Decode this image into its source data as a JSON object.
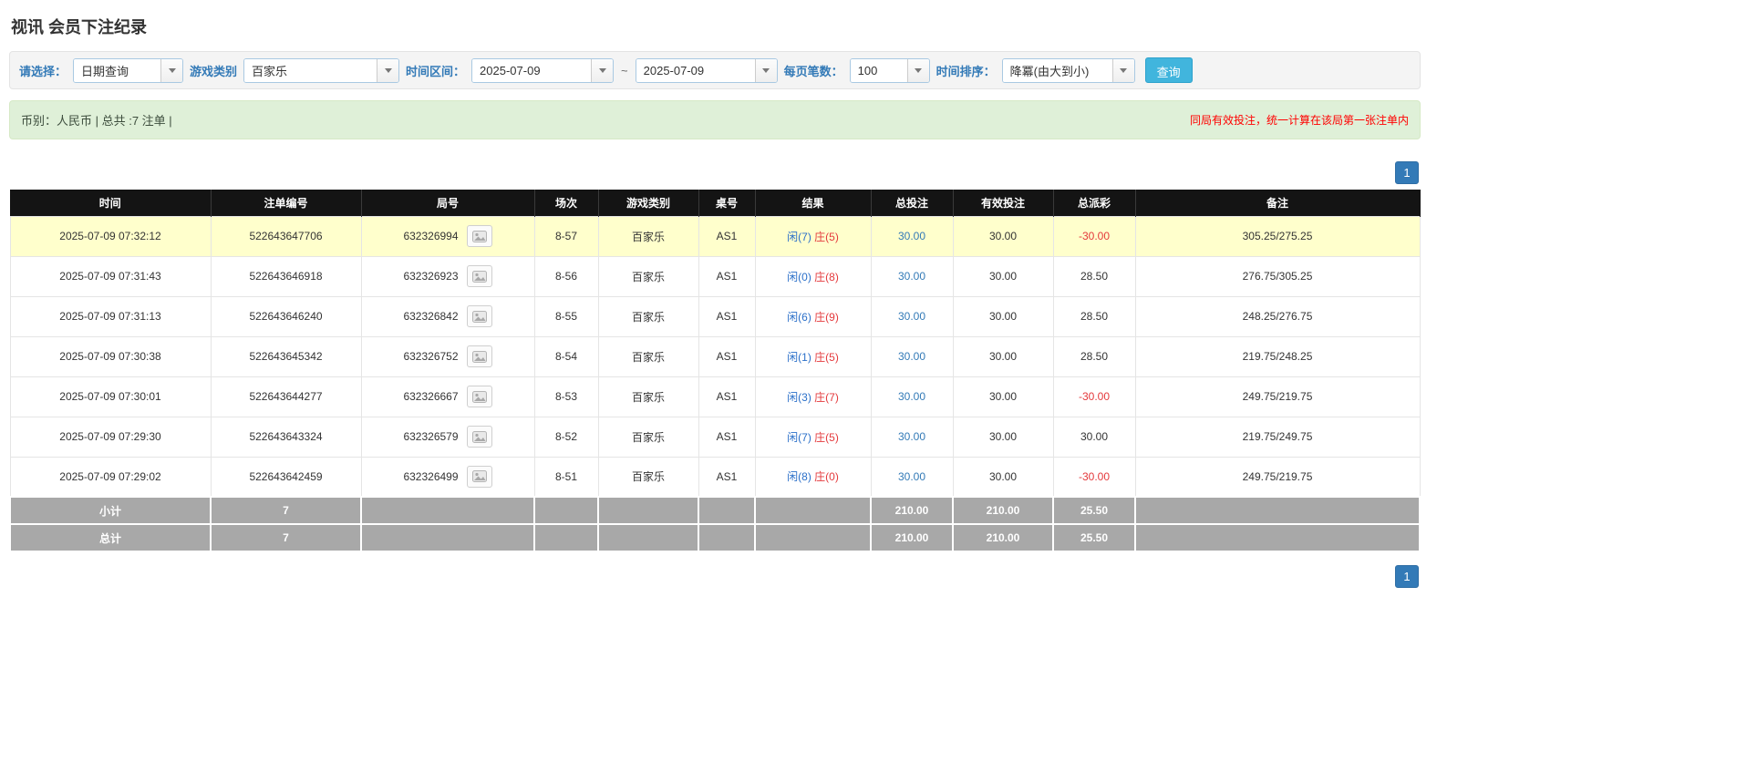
{
  "page": {
    "title": "视讯 会员下注纪录"
  },
  "colors": {
    "accent_blue": "#337ab7",
    "search_button_blue": "#41b5dd",
    "highlight_yellow": "#ffffcc",
    "player_blue": "#2a6fc9",
    "banker_red": "#e4393c",
    "negative_red": "#e4393c",
    "success_bar_bg": "#dff0d8",
    "header_black": "#141414",
    "footer_gray": "#a8a8a8"
  },
  "filters": {
    "select_label": "请选择：",
    "select_value": "日期查询",
    "game_type_label": "游戏类别",
    "game_type_value": "百家乐",
    "time_range_label": "时间区间：",
    "time_from": "2025-07-09",
    "range_separator": "~",
    "time_to": "2025-07-09",
    "per_page_label": "每页笔数：",
    "per_page_value": "100",
    "sort_label": "时间排序：",
    "sort_value": "降冪(由大到小)",
    "search_button": "查询"
  },
  "summary": {
    "left": "币别：人民币 | 总共 :7 注单 |",
    "right": "同局有效投注，统一计算在该局第一张注单内"
  },
  "pagination": {
    "page": "1"
  },
  "table": {
    "headers": [
      "时间",
      "注单编号",
      "局号",
      "场次",
      "游戏类别",
      "桌号",
      "结果",
      "总投注",
      "有效投注",
      "总派彩",
      "备注"
    ],
    "rows": [
      {
        "time": "2025-07-09 07:32:12",
        "bet_id": "522643647706",
        "round_id": "632326994",
        "session": "8-57",
        "game": "百家乐",
        "table_no": "AS1",
        "result_player": "闲(7)",
        "result_banker": "庄(5)",
        "total_bet": "30.00",
        "valid_bet": "30.00",
        "payout": "-30.00",
        "note": "305.25/275.25",
        "highlighted": true
      },
      {
        "time": "2025-07-09 07:31:43",
        "bet_id": "522643646918",
        "round_id": "632326923",
        "session": "8-56",
        "game": "百家乐",
        "table_no": "AS1",
        "result_player": "闲(0)",
        "result_banker": "庄(8)",
        "total_bet": "30.00",
        "valid_bet": "30.00",
        "payout": "28.50",
        "note": "276.75/305.25",
        "highlighted": false
      },
      {
        "time": "2025-07-09 07:31:13",
        "bet_id": "522643646240",
        "round_id": "632326842",
        "session": "8-55",
        "game": "百家乐",
        "table_no": "AS1",
        "result_player": "闲(6)",
        "result_banker": "庄(9)",
        "total_bet": "30.00",
        "valid_bet": "30.00",
        "payout": "28.50",
        "note": "248.25/276.75",
        "highlighted": false
      },
      {
        "time": "2025-07-09 07:30:38",
        "bet_id": "522643645342",
        "round_id": "632326752",
        "session": "8-54",
        "game": "百家乐",
        "table_no": "AS1",
        "result_player": "闲(1)",
        "result_banker": "庄(5)",
        "total_bet": "30.00",
        "valid_bet": "30.00",
        "payout": "28.50",
        "note": "219.75/248.25",
        "highlighted": false
      },
      {
        "time": "2025-07-09 07:30:01",
        "bet_id": "522643644277",
        "round_id": "632326667",
        "session": "8-53",
        "game": "百家乐",
        "table_no": "AS1",
        "result_player": "闲(3)",
        "result_banker": "庄(7)",
        "total_bet": "30.00",
        "valid_bet": "30.00",
        "payout": "-30.00",
        "note": "249.75/219.75",
        "highlighted": false
      },
      {
        "time": "2025-07-09 07:29:30",
        "bet_id": "522643643324",
        "round_id": "632326579",
        "session": "8-52",
        "game": "百家乐",
        "table_no": "AS1",
        "result_player": "闲(7)",
        "result_banker": "庄(5)",
        "total_bet": "30.00",
        "valid_bet": "30.00",
        "payout": "30.00",
        "note": "219.75/249.75",
        "highlighted": false
      },
      {
        "time": "2025-07-09 07:29:02",
        "bet_id": "522643642459",
        "round_id": "632326499",
        "session": "8-51",
        "game": "百家乐",
        "table_no": "AS1",
        "result_player": "闲(8)",
        "result_banker": "庄(0)",
        "total_bet": "30.00",
        "valid_bet": "30.00",
        "payout": "-30.00",
        "note": "249.75/219.75",
        "highlighted": false
      }
    ],
    "footer_rows": [
      {
        "label": "小计",
        "count": "7",
        "total_bet": "210.00",
        "valid_bet": "210.00",
        "payout": "25.50"
      },
      {
        "label": "总计",
        "count": "7",
        "total_bet": "210.00",
        "valid_bet": "210.00",
        "payout": "25.50"
      }
    ]
  }
}
